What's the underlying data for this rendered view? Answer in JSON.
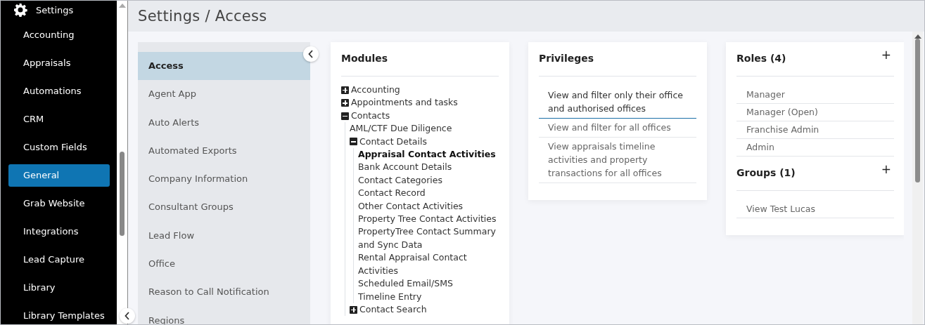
{
  "sidebar": {
    "header": "Settings",
    "items": [
      {
        "label": "Accounting",
        "selected": false
      },
      {
        "label": "Appraisals",
        "selected": false
      },
      {
        "label": "Automations",
        "selected": false
      },
      {
        "label": "CRM",
        "selected": false
      },
      {
        "label": "Custom Fields",
        "selected": false
      },
      {
        "label": "General",
        "selected": true
      },
      {
        "label": "Grab Website",
        "selected": false
      },
      {
        "label": "Integrations",
        "selected": false
      },
      {
        "label": "Lead Capture",
        "selected": false
      },
      {
        "label": "Library",
        "selected": false
      },
      {
        "label": "Library Templates",
        "selected": false
      }
    ]
  },
  "page_title": "Settings / Access",
  "settings_menu": {
    "items": [
      {
        "label": "Access",
        "selected": true
      },
      {
        "label": "Agent App",
        "selected": false
      },
      {
        "label": "Auto Alerts",
        "selected": false
      },
      {
        "label": "Automated Exports",
        "selected": false
      },
      {
        "label": "Company Information",
        "selected": false
      },
      {
        "label": "Consultant Groups",
        "selected": false
      },
      {
        "label": "Lead Flow",
        "selected": false
      },
      {
        "label": "Office",
        "selected": false
      },
      {
        "label": "Reason to Call Notification",
        "selected": false
      },
      {
        "label": "Regions",
        "selected": false
      }
    ]
  },
  "modules": {
    "title": "Modules",
    "items": [
      {
        "label": "Accounting",
        "kind": "folder",
        "expanded": false,
        "selected": false
      },
      {
        "label": "Appointments and tasks",
        "kind": "folder",
        "expanded": false,
        "selected": false
      },
      {
        "label": "Contacts",
        "kind": "folder",
        "expanded": true,
        "selected": false,
        "children": [
          {
            "label": "AML/CTF Due Diligence",
            "kind": "leaf",
            "selected": false
          },
          {
            "label": "Contact Details",
            "kind": "folder",
            "expanded": true,
            "selected": false,
            "children": [
              {
                "label": "Appraisal Contact Activities",
                "selected": true
              },
              {
                "label": "Bank Account Details",
                "selected": false
              },
              {
                "label": "Contact Categories",
                "selected": false
              },
              {
                "label": "Contact Record",
                "selected": false
              },
              {
                "label": "Other Contact Activities",
                "selected": false
              },
              {
                "label": "Property Tree Contact Activities",
                "selected": false
              },
              {
                "label": "PropertyTree Contact Summary and Sync Data",
                "selected": false
              },
              {
                "label": "Rental Appraisal Contact Activities",
                "selected": false
              },
              {
                "label": "Scheduled Email/SMS",
                "selected": false
              },
              {
                "label": "Timeline Entry",
                "selected": false
              }
            ]
          },
          {
            "label": "Contact Search",
            "kind": "folder",
            "expanded": false,
            "selected": false
          }
        ]
      }
    ]
  },
  "privileges": {
    "title": "Privileges",
    "items": [
      {
        "label": "View and filter only their office and authorised offices",
        "selected": true
      },
      {
        "label": "View and filter for all offices",
        "selected": false
      },
      {
        "label": "View appraisals timeline activities and property transactions for all offices",
        "selected": false
      }
    ]
  },
  "roles": {
    "title": "Roles (4)",
    "add": "+",
    "items": [
      "Manager",
      "Manager (Open)",
      "Franchise Admin",
      "Admin"
    ]
  },
  "groups": {
    "title": "Groups (1)",
    "add": "+",
    "items": [
      "View Test Lucas"
    ]
  }
}
